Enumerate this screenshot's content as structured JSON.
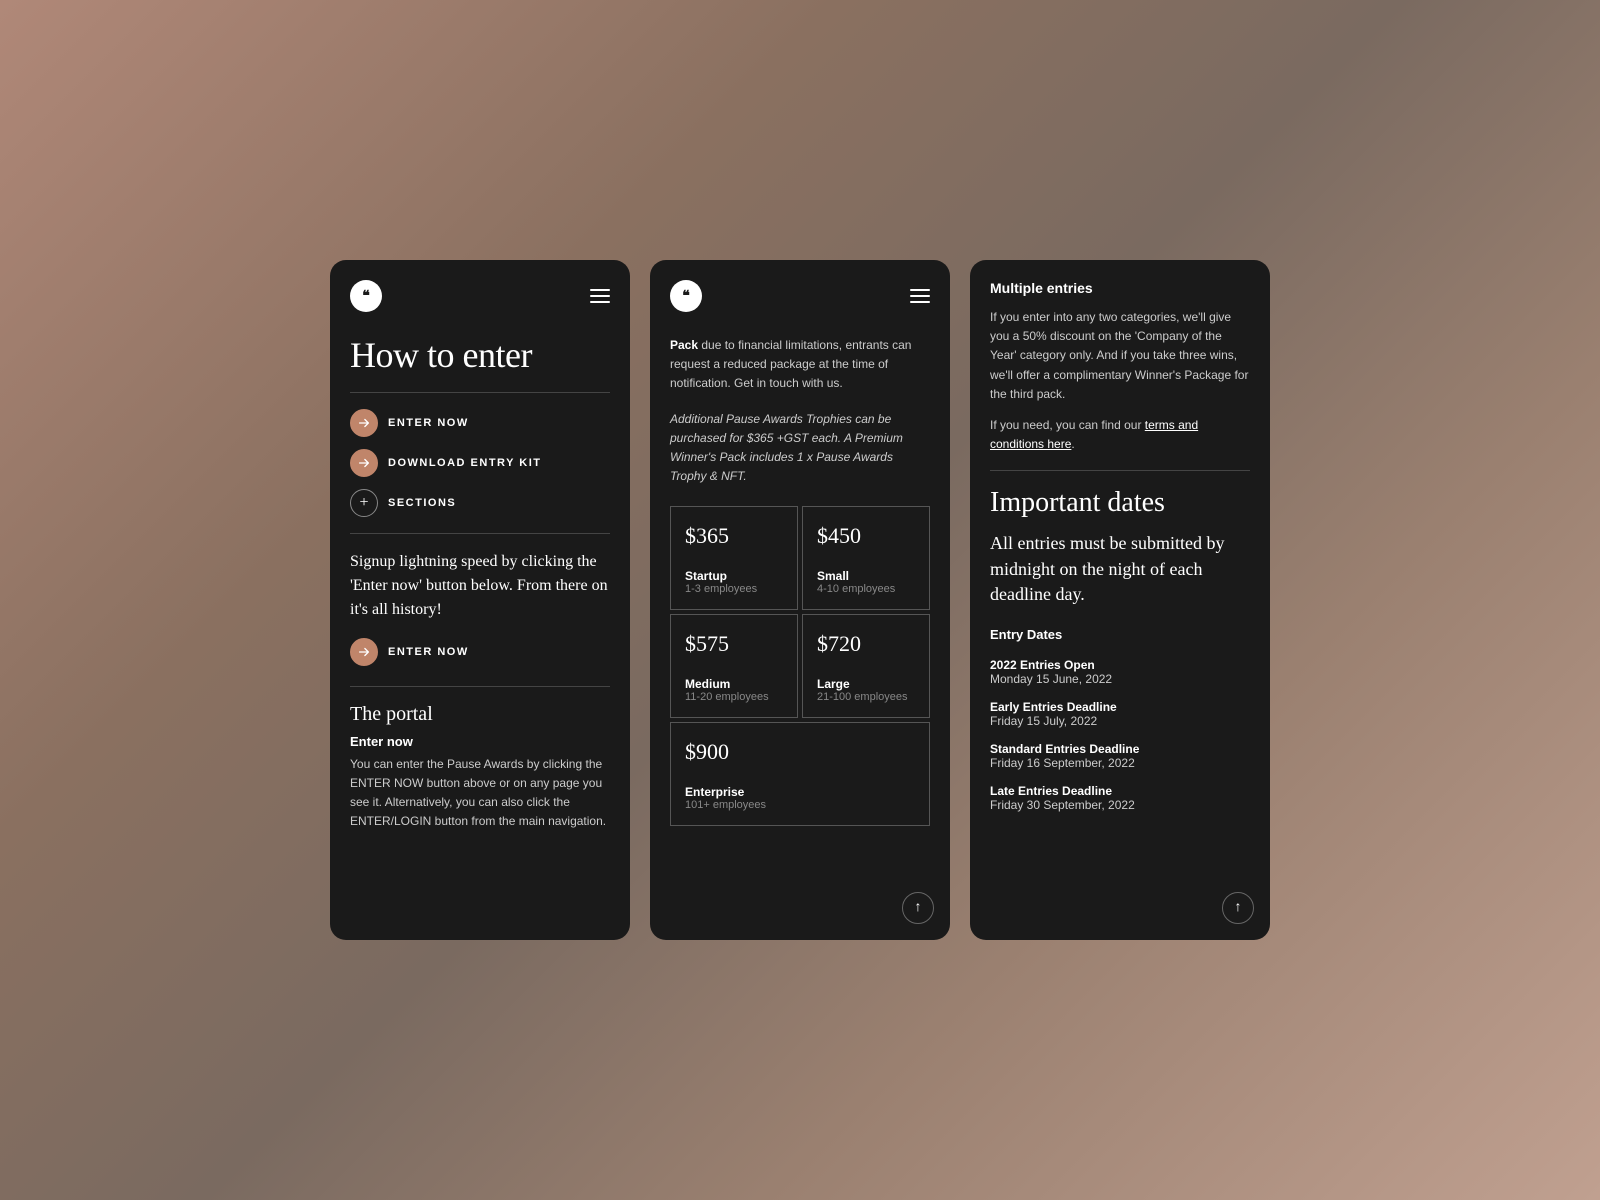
{
  "panel1": {
    "logo": "❝",
    "title": "How to enter",
    "nav_items": [
      {
        "id": "enter-now-1",
        "label": "ENTER NOW",
        "icon": "arrow"
      },
      {
        "id": "download-entry-kit",
        "label": "DOWNLOAD ENTRY KIT",
        "icon": "arrow"
      },
      {
        "id": "sections",
        "label": "SECTIONS",
        "icon": "plus"
      }
    ],
    "body_text": "Signup lightning speed by clicking the 'Enter now' button below. From there on it's all history!",
    "enter_now_label": "ENTER NOW",
    "the_portal_title": "The portal",
    "enter_now_section": "Enter now",
    "portal_body": "You can enter the Pause Awards by clicking the ENTER NOW button above or on any page you see it. Alternatively, you can also click the ENTER/LOGIN button from the main navigation."
  },
  "panel2": {
    "logo": "❝",
    "pack_text_bold": "Pack",
    "pack_text": " due to financial limitations, entrants can request a reduced package at the time of notification. Get in touch with us.",
    "italic_text": "Additional Pause Awards Trophies can be purchased for $365 +GST each. A Premium Winner's Pack includes 1 x Pause Awards Trophy & NFT.",
    "pricing": [
      {
        "price": "$365",
        "tier": "Startup",
        "employees": "1-3 employees"
      },
      {
        "price": "$450",
        "tier": "Small",
        "employees": "4-10 employees"
      },
      {
        "price": "$575",
        "tier": "Medium",
        "employees": "11-20 employees"
      },
      {
        "price": "$720",
        "tier": "Large",
        "employees": "21-100 employees"
      },
      {
        "price": "$900",
        "tier": "Enterprise",
        "employees": "101+ employees",
        "full_width": true
      }
    ]
  },
  "panel3": {
    "logo": "❝",
    "multiple_entries_title": "Multiple entries",
    "multiple_entries_text1": "If you enter into any two categories, we'll give you a 50% discount on the 'Company of the Year' category only. And if you take three wins, we'll offer a complimentary Winner's Package for the third pack.",
    "multiple_entries_text2": "If you need, you can find our ",
    "terms_link": "terms and conditions here",
    "terms_link_suffix": ".",
    "important_dates_title": "Important dates",
    "important_dates_subtitle": "All entries must be submitted by midnight on the night of each deadline day.",
    "entry_dates_heading": "Entry Dates",
    "dates": [
      {
        "title": "2022 Entries Open",
        "date": "Monday 15 June, 2022"
      },
      {
        "title": "Early Entries Deadline",
        "date": "Friday 15 July, 2022"
      },
      {
        "title": "Standard Entries Deadline",
        "date": "Friday 16 September, 2022"
      },
      {
        "title": "Late Entries Deadline",
        "date": "Friday 30 September, 2022"
      }
    ]
  }
}
